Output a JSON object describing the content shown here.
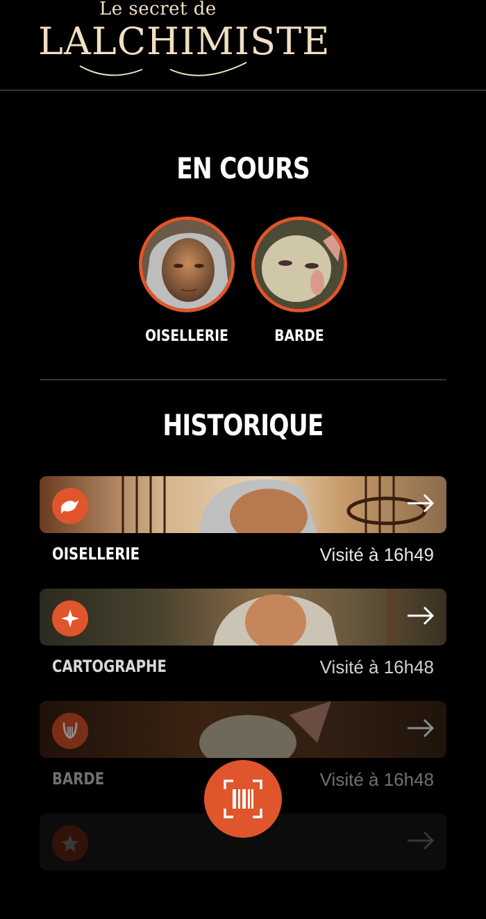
{
  "header": {
    "logo_small": "Le secret de",
    "logo_big": "LALCHIMISTE"
  },
  "en_cours": {
    "title": "EN COURS",
    "items": [
      {
        "label": "OISELLERIE"
      },
      {
        "label": "BARDE"
      }
    ]
  },
  "historique": {
    "title": "HISTORIQUE",
    "items": [
      {
        "title": "OISELLERIE",
        "time": "Visité à 16h49",
        "icon": "bird-icon"
      },
      {
        "title": "CARTOGRAPHE",
        "time": "Visité à 16h48",
        "icon": "compass-star-icon"
      },
      {
        "title": "BARDE",
        "time": "Visité à 16h48",
        "icon": "lyre-icon"
      },
      {
        "title": "",
        "time": "",
        "icon": "star-icon"
      }
    ]
  },
  "colors": {
    "accent": "#e0552b",
    "logo": "#f1dfc3",
    "background": "#000000"
  },
  "scan_button": {
    "icon": "barcode-scan-icon"
  }
}
